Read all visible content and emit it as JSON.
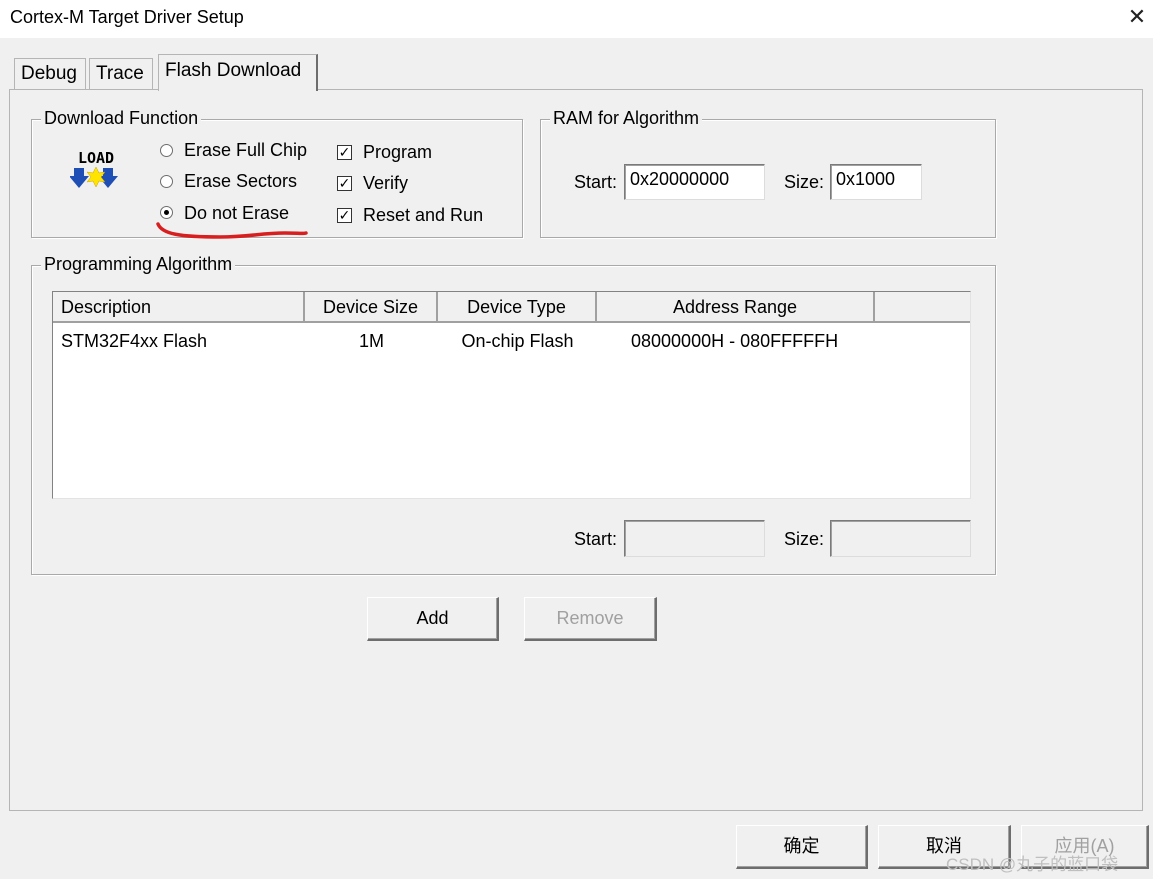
{
  "window": {
    "title": "Cortex-M Target Driver Setup",
    "close_glyph": "✕"
  },
  "tabs": [
    {
      "label": "Debug"
    },
    {
      "label": "Trace"
    },
    {
      "label": "Flash Download",
      "active": true
    }
  ],
  "download_function": {
    "legend": "Download Function",
    "icon_text": "LOAD",
    "radios": [
      {
        "label": "Erase Full Chip",
        "checked": false
      },
      {
        "label": "Erase Sectors",
        "checked": false
      },
      {
        "label": "Do not Erase",
        "checked": true
      }
    ],
    "checkboxes": [
      {
        "label": "Program",
        "checked": true
      },
      {
        "label": "Verify",
        "checked": true
      },
      {
        "label": "Reset and Run",
        "checked": true
      }
    ]
  },
  "ram_for_algorithm": {
    "legend": "RAM for Algorithm",
    "start_label": "Start:",
    "start_value": "0x20000000",
    "size_label": "Size:",
    "size_value": "0x1000"
  },
  "programming_algorithm": {
    "legend": "Programming Algorithm",
    "columns": [
      "Description",
      "Device Size",
      "Device Type",
      "Address Range"
    ],
    "rows": [
      {
        "description": "STM32F4xx Flash",
        "device_size": "1M",
        "device_type": "On-chip Flash",
        "address_range": "08000000H - 080FFFFFH"
      }
    ],
    "start_label": "Start:",
    "start_value": "",
    "size_label": "Size:",
    "size_value": ""
  },
  "buttons": {
    "add": "Add",
    "remove": "Remove"
  },
  "footer": {
    "ok": "确定",
    "cancel": "取消",
    "apply": "应用(A)"
  },
  "watermark": "CSDN @丸子的蓝口袋",
  "colors": {
    "annotation_underline": "#d81e1e",
    "dialog_bg": "#f0f0f0"
  }
}
